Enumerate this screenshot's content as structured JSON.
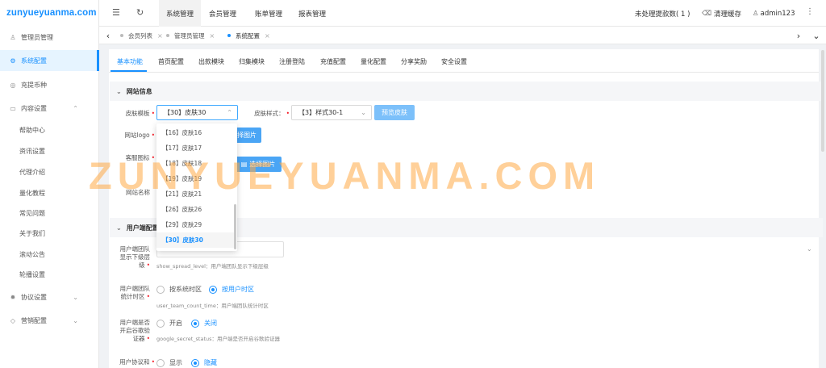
{
  "logo": "zunyueyuanma.com",
  "sidebar": {
    "items": [
      {
        "icon": "user-icon",
        "glyph": "♙",
        "label": "管理员管理"
      },
      {
        "icon": "gear-icon",
        "glyph": "⚙",
        "label": "系统配置"
      },
      {
        "icon": "coin-icon",
        "glyph": "◎",
        "label": "充提币种"
      },
      {
        "icon": "content-icon",
        "glyph": "▭",
        "label": "内容设置"
      }
    ],
    "subitems": [
      "帮助中心",
      "资讯设置",
      "代理介绍",
      "量化教程",
      "常见问题",
      "关于我们",
      "滚动公告",
      "轮播设置"
    ],
    "bottom": [
      {
        "icon": "agreement-icon",
        "glyph": "✹",
        "label": "协议设置"
      },
      {
        "icon": "diamond-icon",
        "glyph": "◇",
        "label": "营销配置"
      }
    ]
  },
  "topbar": {
    "nav": [
      "系统管理",
      "会员管理",
      "账单管理",
      "报表管理"
    ],
    "withdraw_text": "未处理提款数( 1 )",
    "cache_text": "清理缓存",
    "user_text": "admin123"
  },
  "tabs": [
    "会员列表",
    "管理员管理",
    "系统配置"
  ],
  "subtabs": [
    "基本功能",
    "首页配置",
    "出款模块",
    "归集模块",
    "注册登陆",
    "充值配置",
    "量化配置",
    "分享奖励",
    "安全设置"
  ],
  "section_site": {
    "title": "网站信息",
    "skin_template_label": "皮肤模板",
    "skin_template_value": "【30】皮肤30",
    "skin_style_label": "皮肤样式",
    "skin_style_value": "【3】样式30-1",
    "preview_button": "预览皮肤",
    "logo_label": "网站logo",
    "logo_button": "择图片",
    "service_icon_label": "客服图标",
    "service_icon_button": "选择图片",
    "site_name_label": "网站名称"
  },
  "dropdown_options": [
    "【16】皮肤16",
    "【17】皮肤17",
    "【18】皮肤18",
    "【19】皮肤19",
    "【21】皮肤21",
    "【26】皮肤26",
    "【29】皮肤29",
    "【30】皮肤30"
  ],
  "section_user": {
    "title": "用户端配置",
    "team_level_label": "用户端团队显示下级层级",
    "team_level_hint": "show_spread_level：用户端团队显示下级层级",
    "team_timezone_label": "用户端团队统计时区",
    "team_timezone_options": [
      "按系统时区",
      "按用户时区"
    ],
    "team_timezone_hint": "user_team_count_time：用户端团队统计时区",
    "google_label": "用户端是否开启谷歌验证器",
    "google_options": [
      "开启",
      "关闭"
    ],
    "google_hint": "google_secret_status：用户端是否开启谷歌验证器",
    "agreement_label": "用户协议和",
    "agreement_options": [
      "显示",
      "隐藏"
    ]
  },
  "watermark": "ZUNYUEYUANMA.COM",
  "colors": {
    "accent": "#1890ff",
    "watermark": "#ffaa46"
  }
}
